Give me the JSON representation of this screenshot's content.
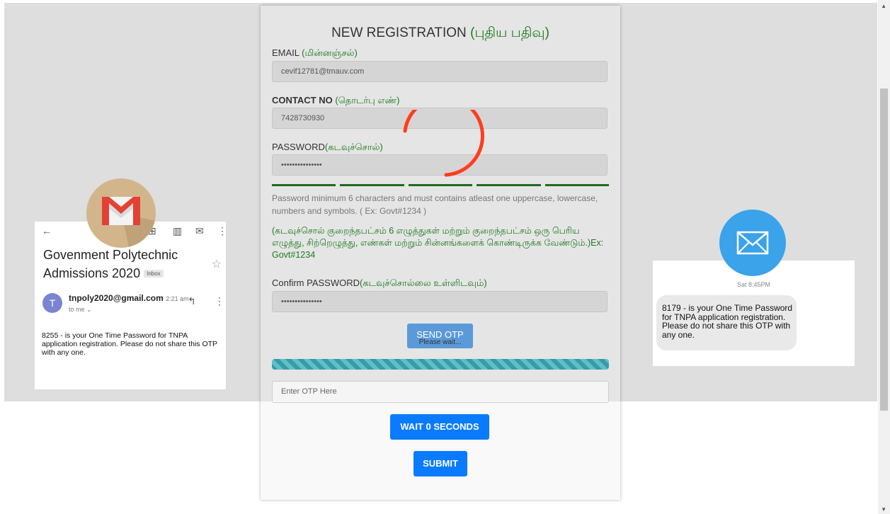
{
  "colors": {
    "accent_blue": "#0a7bff",
    "tamil_green": "#1f7a1f",
    "spinner": "#ff3d1f",
    "sms_blue": "#3aa3ea"
  },
  "gmail": {
    "subject_line1": "Govenment Polytechnic",
    "subject_line2": "Admissions 2020",
    "inbox_badge": "Inbox",
    "avatar_letter": "T",
    "sender": "tnpoly2020@gmail.com",
    "time": "2:21 am",
    "to": "to me ⌄",
    "body": "8255 - is your One Time Password for TNPA application registration. Please do not share this OTP with any one."
  },
  "sms": {
    "time": "Sat 8:45PM",
    "message": "8179 - is your One Time Password for TNPA application registration. Please do not share this OTP with any one."
  },
  "form": {
    "title": "NEW REGISTRATION",
    "title_ta": "(புதிய பதிவு)",
    "email_label": "EMAIL",
    "email_label_ta": "(மின்னஞ்சல்)",
    "email_value": "cevif12781@tmauv.com",
    "contact_label": "CONTACT NO",
    "contact_label_ta": "(தொடர்பு எண்)",
    "contact_value": "7428730930",
    "password_label": "PASSWORD",
    "password_label_ta": "(கடவுச்சொல்)",
    "password_value": "•••••••••••••••",
    "hint_en": "Password minimum 6 characters and must contains atleast one uppercase, lowercase, numbers and symbols. ( Ex: Govt#1234 )",
    "hint_ta": "(கடவுச்சொல் குறைந்தபட்சம் 6 எழுத்துகள் மற்றும் குறைந்தபட்சம் ஒரு பெரிய எழுத்து, சிற்றெழுத்து, எண்கள் மற்றும் சின்னங்களைக் கொண்டிருக்க வேண்டும்.)Ex: Govt#1234",
    "confirm_label": "Confirm PASSWORD",
    "confirm_label_ta": "(கடவுச்சொல்லை உள்ளிடவும்)",
    "confirm_value": "•••••••••••••••",
    "send_otp": "SEND OTP",
    "please_wait": "Please wait...",
    "otp_placeholder": "Enter OTP Here",
    "wait_button": "WAIT 0 SECONDS",
    "submit_button": "SUBMIT"
  }
}
